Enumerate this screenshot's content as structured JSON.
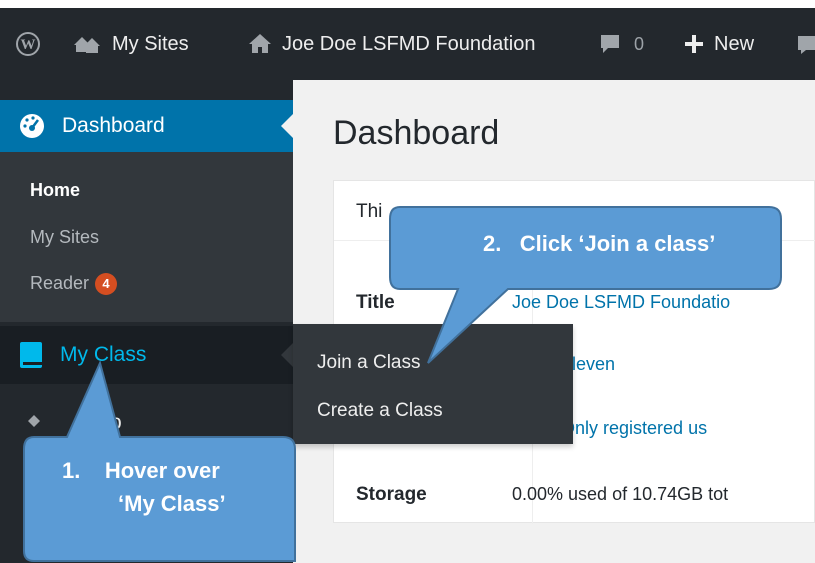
{
  "adminbar": {
    "my_sites": "My Sites",
    "site_name": "Joe Doe LSFMD Foundation",
    "comments_count": "0",
    "new_label": "New"
  },
  "sidebar": {
    "dashboard": "Dashboard",
    "submenu": {
      "home": "Home",
      "my_sites": "My Sites",
      "reader": "Reader",
      "reader_badge": "4"
    },
    "my_class": "My Class",
    "next_item": "o"
  },
  "flyout": {
    "join": "Join a Class",
    "create": "Create a Class"
  },
  "main": {
    "title": "Dashboard",
    "panel_head": "Thi",
    "rows": [
      {
        "label": "Title",
        "value": "Joe Doe LSFMD Foundatio"
      },
      {
        "label": "",
        "value": "venty Eleven"
      },
      {
        "label": "",
        "value": "ivate (Only registered us"
      },
      {
        "label": "Storage",
        "value": "0.00% used of 10.74GB tot"
      }
    ]
  },
  "callouts": {
    "step1_num": "1.",
    "step1_line1": "Hover over",
    "step1_line2": "‘My Class’",
    "step2_num": "2.",
    "step2_text": "Click ‘Join a class’"
  },
  "colors": {
    "adminbar_bg": "#23282d",
    "accent_blue": "#0073aa",
    "link_blue": "#00b9eb",
    "badge_orange": "#d54e21",
    "callout_fill": "#5b9bd5",
    "callout_stroke": "#41719c"
  }
}
